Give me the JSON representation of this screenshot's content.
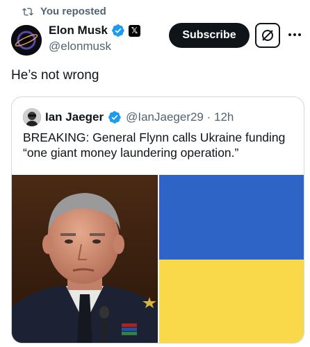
{
  "repost": {
    "label": "You reposted"
  },
  "author": {
    "name": "Elon Musk",
    "handle": "@elonmusk",
    "affiliate_badge": "𝕏"
  },
  "actions": {
    "subscribe_label": "Subscribe"
  },
  "tweet": {
    "text": "He’s not wrong"
  },
  "quote": {
    "name": "Ian Jaeger",
    "handle_time": "@IanJaeger29 · 12h",
    "text": "BREAKING: General Flynn calls Ukraine funding “one giant money laundering operation.”"
  },
  "colors": {
    "text_primary": "#0f1419",
    "text_secondary": "#536471",
    "verified_blue": "#1d9bf0",
    "flag_blue": "#2d64c6",
    "flag_yellow": "#f9d949"
  },
  "icons": {
    "repost": "repost-icon",
    "verified": "verified-badge-icon",
    "grok": "grok-icon",
    "more": "more-dots-icon"
  }
}
